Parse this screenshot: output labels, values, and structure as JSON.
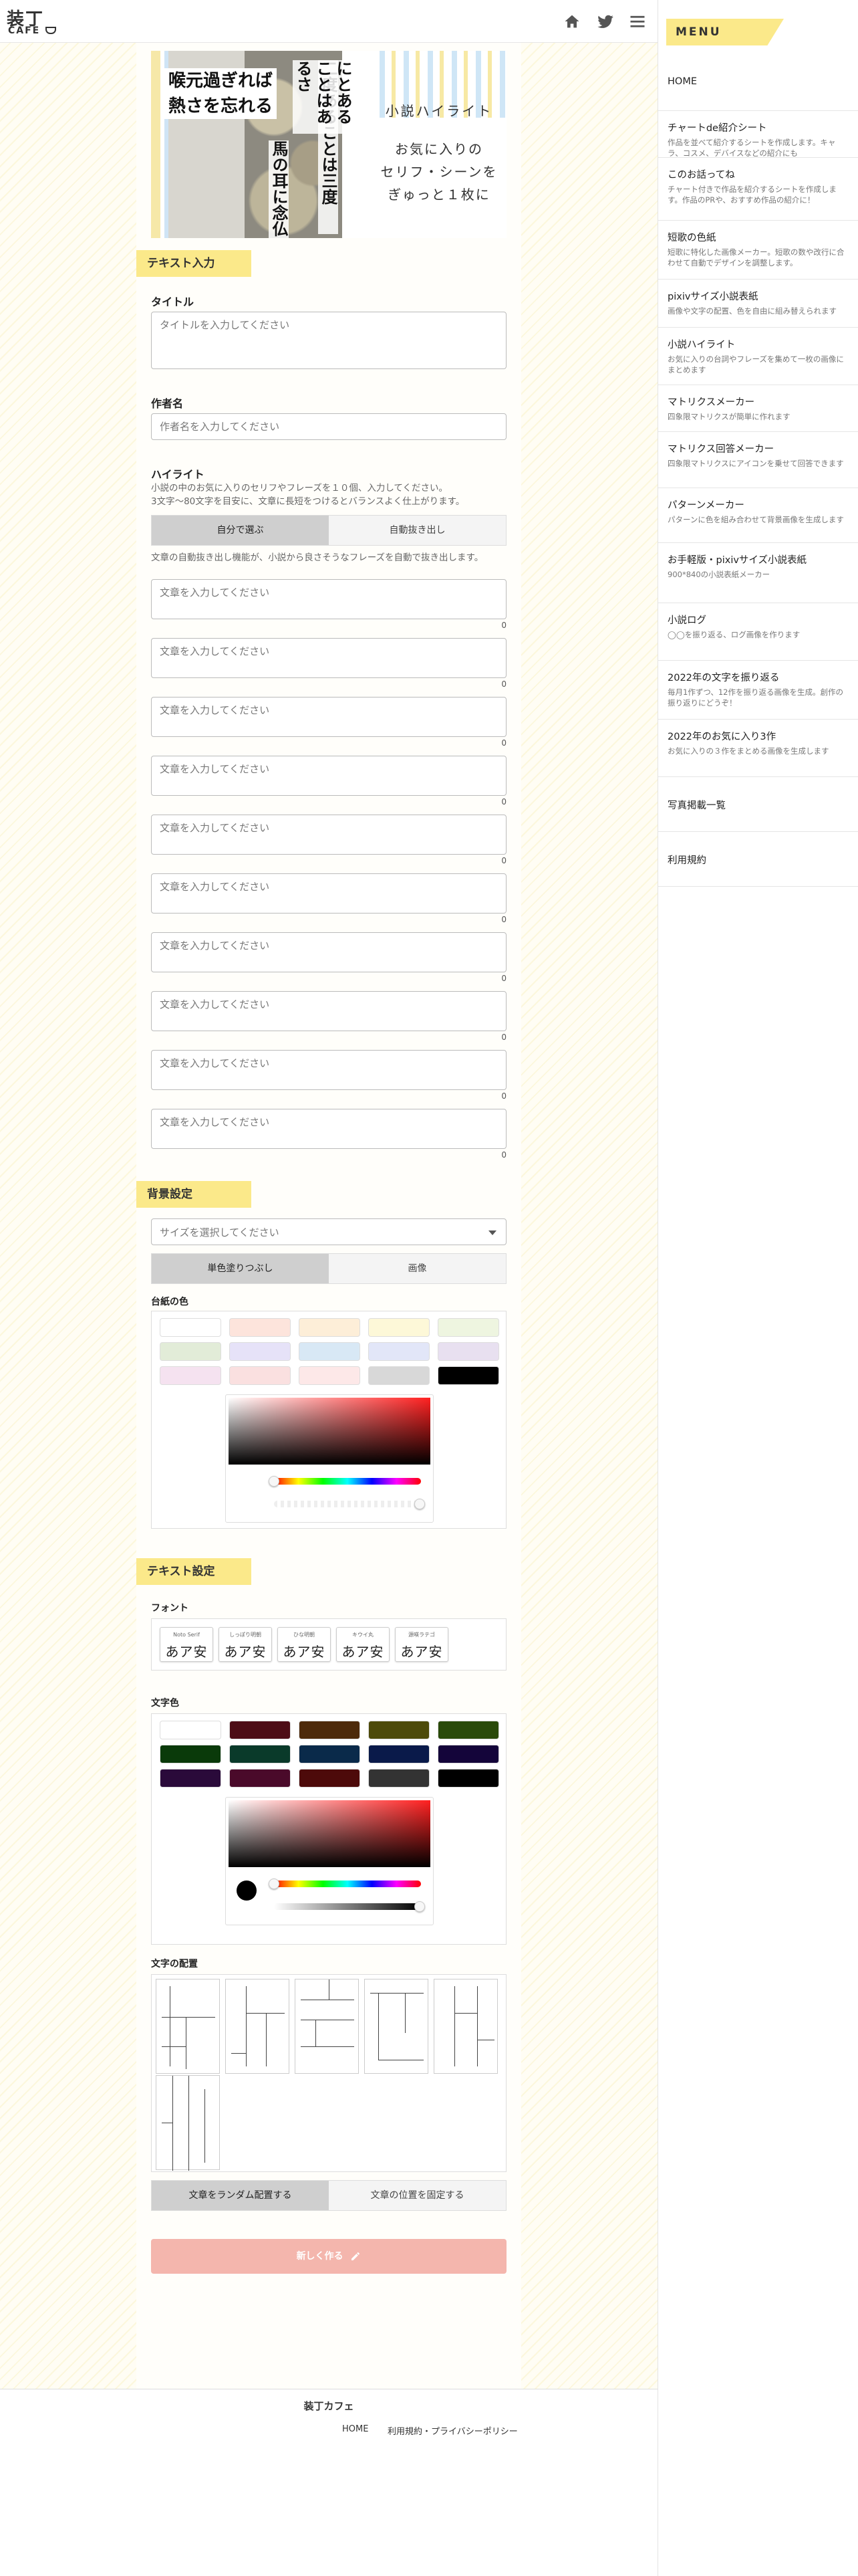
{
  "header": {
    "logo_text": "装丁",
    "logo_sub": "CAFE"
  },
  "hero": {
    "left_text": "喉元過ぎれば\n熱さを忘れる",
    "vert1": "二度あることは三度",
    "vert2": "にとあることはあるさ",
    "vert3": "馬の耳に念仏",
    "right_title": "小説ハイライト",
    "right_body": "お気に入りの\nセリフ・シーンを\nぎゅっと１枚に"
  },
  "text_section": {
    "heading": "テキスト入力",
    "title_label": "タイトル",
    "title_placeholder": "タイトルを入力してください",
    "author_label": "作者名",
    "author_placeholder": "作者名を入力してください",
    "highlight_label": "ハイライト",
    "highlight_desc": "小説の中のお気に入りのセリフやフレーズを１０個、入力してください。\n3文字〜80文字を目安に、文章に長短をつけるとバランスよく仕上がります。",
    "mode_tabs": [
      "自分で選ぶ",
      "自動抜き出し"
    ],
    "auto_desc": "文章の自動抜き出し機能が、小説から良さそうなフレーズを自動で抜き出します。",
    "sentence_placeholder": "文章を入力してください",
    "sentence_count": "0"
  },
  "bg_section": {
    "heading": "背景設定",
    "size_placeholder": "サイズを選択してください",
    "mode_tabs": [
      "単色塗りつぶし",
      "画像"
    ],
    "paper_label": "台紙の色",
    "paper_colors": [
      "#ffffff",
      "#fde4dc",
      "#fdeed8",
      "#fdf8d8",
      "#eef5e0",
      "#e2ecd8",
      "#e6e2f8",
      "#d8e8f5",
      "#e2e6f8",
      "#e8e0f0",
      "#f5e2f0",
      "#fae0e0",
      "#fde8e8",
      "#d8d8d8",
      "#000000"
    ]
  },
  "text_settings": {
    "heading": "テキスト設定",
    "font_label": "フォント",
    "fonts": [
      {
        "name": "Noto Serif",
        "sample": "あア安"
      },
      {
        "name": "しっぽり明朝",
        "sample": "あア安"
      },
      {
        "name": "ひな明朝",
        "sample": "あア安"
      },
      {
        "name": "キウイ丸",
        "sample": "あア安"
      },
      {
        "name": "源暎ラテゴ",
        "sample": "あア安"
      }
    ],
    "color_label": "文字色",
    "text_colors": [
      "#ffffff",
      "#4d0d16",
      "#4d2a0a",
      "#4d4a0a",
      "#2a4a0a",
      "#0a3a0a",
      "#0a3a2a",
      "#0a2a4a",
      "#0a1a4a",
      "#14053a",
      "#2a0a3a",
      "#4a0a2a",
      "#4d0a0a",
      "#333333",
      "#000000"
    ],
    "layout_label": "文字の配置",
    "layout_tabs": [
      "文章をランダム配置する",
      "文章の位置を固定する"
    ],
    "create_button": "新しく作る"
  },
  "footer": {
    "site_name": "装丁カフェ",
    "links": [
      "HOME",
      "利用規約・プライバシーポリシー"
    ]
  },
  "sidebar": {
    "menu_title": "MENU",
    "items": [
      {
        "title": "HOME",
        "desc": ""
      },
      {
        "title": "チャートde紹介シート",
        "desc": "作品を並べて紹介するシートを作成します。キャラ、コスメ、デバイスなどの紹介にも"
      },
      {
        "title": "このお話ってね",
        "desc": "チャート付きで作品を紹介するシートを作成します。作品のPRや、おすすめ作品の紹介に！"
      },
      {
        "title": "短歌の色紙",
        "desc": "短歌に特化した画像メーカー。短歌の数や改行に合わせて自動でデザインを調整します。"
      },
      {
        "title": "pixivサイズ小説表紙",
        "desc": "画像や文字の配置、色を自由に組み替えられます"
      },
      {
        "title": "小説ハイライト",
        "desc": "お気に入りの台詞やフレーズを集めて一枚の画像にまとめます"
      },
      {
        "title": "マトリクスメーカー",
        "desc": "四象限マトリクスが簡単に作れます"
      },
      {
        "title": "マトリクス回答メーカー",
        "desc": "四象限マトリクスにアイコンを乗せて回答できます"
      },
      {
        "title": "パターンメーカー",
        "desc": "パターンに色を組み合わせて背景画像を生成します"
      },
      {
        "title": "お手軽版・pixivサイズ小説表紙",
        "desc": "900*840の小説表紙メーカー"
      },
      {
        "title": "小説ログ",
        "desc": "◯◯を振り返る、ログ画像を作ります"
      },
      {
        "title": "2022年の文字を振り返る",
        "desc": "毎月1作ずつ、12作を振り返る画像を生成。創作の振り返りにどうぞ！"
      },
      {
        "title": "2022年のお気に入り3作",
        "desc": "お気に入りの３作をまとめる画像を生成します"
      },
      {
        "title": "写真掲載一覧",
        "desc": ""
      },
      {
        "title": "利用規約",
        "desc": ""
      }
    ]
  }
}
